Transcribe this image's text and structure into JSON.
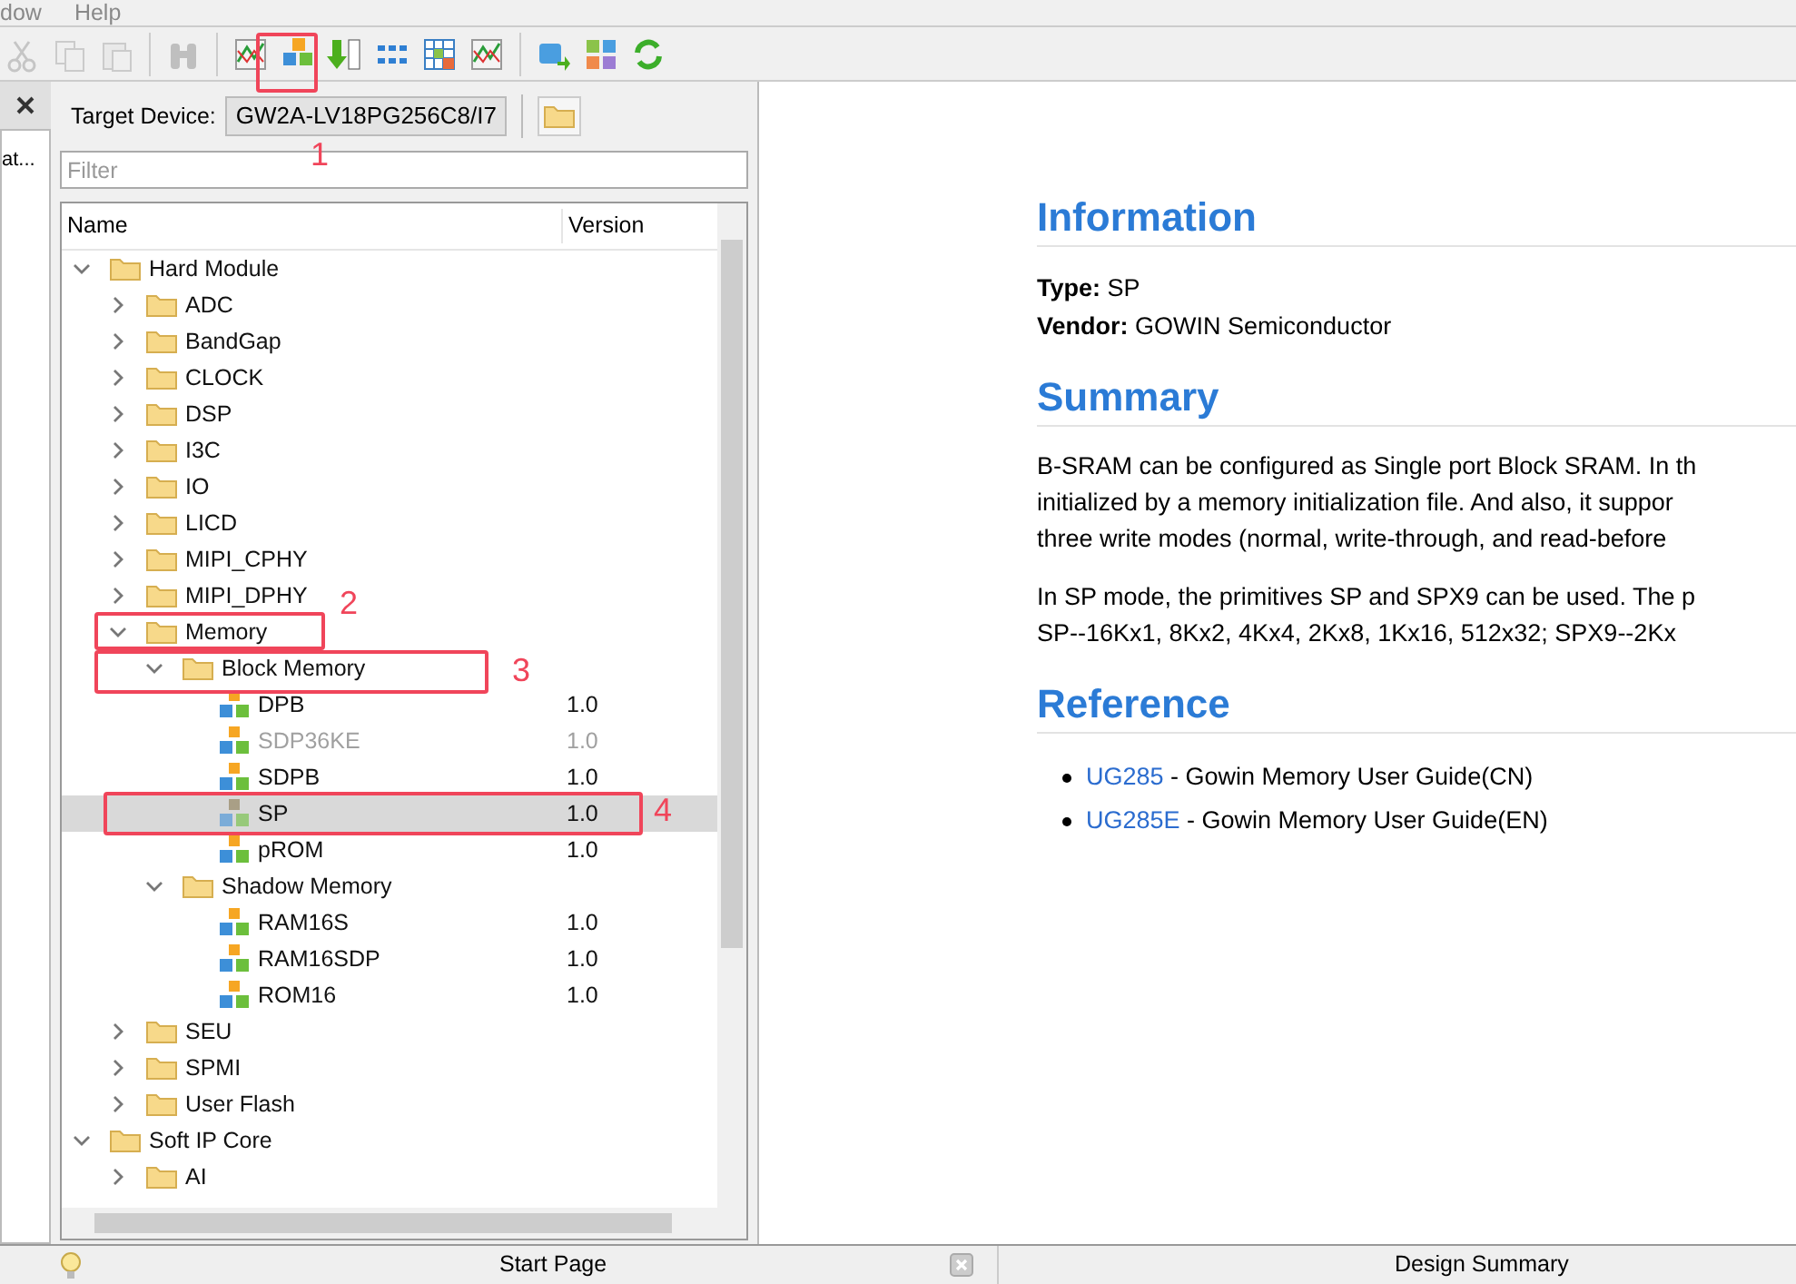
{
  "menu": [
    "dow",
    "Help"
  ],
  "toolbar": [
    {
      "kind": "cut",
      "disabled": true
    },
    {
      "kind": "copy",
      "disabled": true
    },
    {
      "kind": "paste",
      "disabled": true
    },
    {
      "kind": "sep"
    },
    {
      "kind": "find",
      "disabled": true
    },
    {
      "kind": "sep"
    },
    {
      "kind": "wave",
      "disabled": false
    },
    {
      "kind": "cubes",
      "disabled": false
    },
    {
      "kind": "download",
      "disabled": false
    },
    {
      "kind": "dots",
      "disabled": false
    },
    {
      "kind": "grid",
      "disabled": false
    },
    {
      "kind": "wave",
      "disabled": false
    },
    {
      "kind": "sep"
    },
    {
      "kind": "cube-arrow",
      "disabled": false
    },
    {
      "kind": "tiles",
      "disabled": false
    },
    {
      "kind": "refresh",
      "disabled": false
    }
  ],
  "side_tab": {
    "text": "at..."
  },
  "target_device": {
    "label": "Target Device:",
    "value": "GW2A-LV18PG256C8/I7"
  },
  "filter": {
    "placeholder": "Filter"
  },
  "tree": {
    "columns": [
      "Name",
      "Version"
    ],
    "items": [
      {
        "kind": "folder",
        "label": "Hard Module",
        "expanded": true,
        "children": [
          {
            "kind": "folder",
            "label": "ADC",
            "expanded": false
          },
          {
            "kind": "folder",
            "label": "BandGap",
            "expanded": false
          },
          {
            "kind": "folder",
            "label": "CLOCK",
            "expanded": false
          },
          {
            "kind": "folder",
            "label": "DSP",
            "expanded": false
          },
          {
            "kind": "folder",
            "label": "I3C",
            "expanded": false
          },
          {
            "kind": "folder",
            "label": "IO",
            "expanded": false
          },
          {
            "kind": "folder",
            "label": "LICD",
            "expanded": false
          },
          {
            "kind": "folder",
            "label": "MIPI_CPHY",
            "expanded": false
          },
          {
            "kind": "folder",
            "label": "MIPI_DPHY",
            "expanded": false
          },
          {
            "kind": "folder",
            "label": "Memory",
            "expanded": true,
            "children": [
              {
                "kind": "folder",
                "label": "Block Memory",
                "expanded": true,
                "children": [
                  {
                    "kind": "ip",
                    "label": "DPB",
                    "version": "1.0",
                    "selected": false,
                    "disabled": false
                  },
                  {
                    "kind": "ip",
                    "label": "SDP36KE",
                    "version": "1.0",
                    "selected": false,
                    "disabled": true
                  },
                  {
                    "kind": "ip",
                    "label": "SDPB",
                    "version": "1.0",
                    "selected": false,
                    "disabled": false
                  },
                  {
                    "kind": "ip",
                    "label": "SP",
                    "version": "1.0",
                    "selected": true,
                    "disabled": false
                  },
                  {
                    "kind": "ip",
                    "label": "pROM",
                    "version": "1.0",
                    "selected": false,
                    "disabled": false
                  }
                ]
              },
              {
                "kind": "folder",
                "label": "Shadow Memory",
                "expanded": true,
                "children": [
                  {
                    "kind": "ip",
                    "label": "RAM16S",
                    "version": "1.0",
                    "selected": false,
                    "disabled": false
                  },
                  {
                    "kind": "ip",
                    "label": "RAM16SDP",
                    "version": "1.0",
                    "selected": false,
                    "disabled": false
                  },
                  {
                    "kind": "ip",
                    "label": "ROM16",
                    "version": "1.0",
                    "selected": false,
                    "disabled": false
                  }
                ]
              }
            ]
          },
          {
            "kind": "folder",
            "label": "SEU",
            "expanded": false
          },
          {
            "kind": "folder",
            "label": "SPMI",
            "expanded": false
          },
          {
            "kind": "folder",
            "label": "User Flash",
            "expanded": false
          }
        ]
      },
      {
        "kind": "folder",
        "label": "Soft IP Core",
        "expanded": true,
        "children": [
          {
            "kind": "folder",
            "label": "AI",
            "expanded": false
          }
        ]
      }
    ]
  },
  "annotations": [
    "1",
    "2",
    "3",
    "4"
  ],
  "info": {
    "sections": [
      {
        "heading": "Information",
        "kind": "fields",
        "fields": [
          {
            "label": "Type:",
            "value": "SP"
          },
          {
            "label": "Vendor:",
            "value": "GOWIN Semiconductor"
          }
        ]
      },
      {
        "heading": "Summary",
        "kind": "paragraphs",
        "paragraphs": [
          [
            "B-SRAM can be configured as Single port Block SRAM. In th",
            "initialized by a memory initialization file. And also, it suppor",
            "three write modes (normal, write-through, and read-before"
          ],
          [
            "In SP mode, the primitives SP and SPX9 can be used. The p",
            "SP--16Kx1, 8Kx2, 4Kx4, 2Kx8, 1Kx16, 512x32; SPX9--2Kx"
          ]
        ]
      },
      {
        "heading": "Reference",
        "kind": "links",
        "links": [
          {
            "link": "UG285",
            "text": " - Gowin Memory User Guide(CN)"
          },
          {
            "link": "UG285E",
            "text": " - Gowin Memory User Guide(EN)"
          }
        ]
      }
    ]
  },
  "bottom_tabs": [
    {
      "label": "Start Page",
      "closable": true
    },
    {
      "label": "Design Summary",
      "closable": false
    }
  ]
}
